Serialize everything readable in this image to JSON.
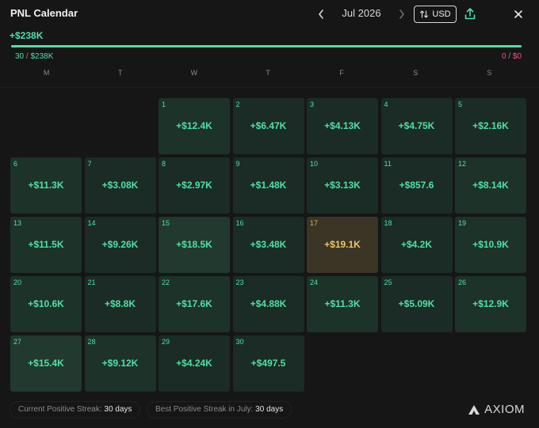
{
  "header": {
    "title": "PNL Calendar",
    "month_label": "Jul 2026",
    "prev_icon": "chevron-left-icon",
    "next_icon": "chevron-right-icon",
    "currency_label": "USD",
    "currency_icon": "swap-vertical-icon",
    "share_icon": "share-upload-icon",
    "close_icon": "close-icon"
  },
  "summary": {
    "total_pnl": "+$238K",
    "gain_progress_fraction": 1.0,
    "gain_count": "30",
    "gain_sep": "/",
    "gain_total": "$238K",
    "loss_count": "0",
    "loss_sep": "/",
    "loss_total": "$0"
  },
  "weekdays": [
    "M",
    "T",
    "W",
    "T",
    "F",
    "S",
    "S"
  ],
  "calendar": {
    "leading_empty_days": 2,
    "today_day": "17",
    "days": [
      {
        "day": "1",
        "value": "+$12.4K"
      },
      {
        "day": "2",
        "value": "+$6.47K"
      },
      {
        "day": "3",
        "value": "+$4.13K"
      },
      {
        "day": "4",
        "value": "+$4.75K"
      },
      {
        "day": "5",
        "value": "+$2.16K"
      },
      {
        "day": "6",
        "value": "+$11.3K"
      },
      {
        "day": "7",
        "value": "+$3.08K"
      },
      {
        "day": "8",
        "value": "+$2.97K"
      },
      {
        "day": "9",
        "value": "+$1.48K"
      },
      {
        "day": "10",
        "value": "+$3.13K"
      },
      {
        "day": "11",
        "value": "+$857.6"
      },
      {
        "day": "12",
        "value": "+$8.14K"
      },
      {
        "day": "13",
        "value": "+$11.5K"
      },
      {
        "day": "14",
        "value": "+$9.26K"
      },
      {
        "day": "15",
        "value": "+$18.5K"
      },
      {
        "day": "16",
        "value": "+$3.48K"
      },
      {
        "day": "17",
        "value": "+$19.1K"
      },
      {
        "day": "18",
        "value": "+$4.2K"
      },
      {
        "day": "19",
        "value": "+$10.9K"
      },
      {
        "day": "20",
        "value": "+$10.6K"
      },
      {
        "day": "21",
        "value": "+$8.8K"
      },
      {
        "day": "22",
        "value": "+$17.6K"
      },
      {
        "day": "23",
        "value": "+$4.88K"
      },
      {
        "day": "24",
        "value": "+$11.3K"
      },
      {
        "day": "25",
        "value": "+$5.09K"
      },
      {
        "day": "26",
        "value": "+$12.9K"
      },
      {
        "day": "27",
        "value": "+$15.4K"
      },
      {
        "day": "28",
        "value": "+$9.12K"
      },
      {
        "day": "29",
        "value": "+$4.24K"
      },
      {
        "day": "30",
        "value": "+$497.5"
      }
    ]
  },
  "footer": {
    "current_streak_label": "Current Positive Streak:",
    "current_streak_value": "30 days",
    "best_streak_label": "Best Positive Streak in July:",
    "best_streak_value": "30 days",
    "logo_text": "AXIOM",
    "logo_icon": "axiom-logo-icon"
  },
  "colors": {
    "gain": "#4fe0a6",
    "loss": "#ff4f7a",
    "today_accent": "#f2c46b",
    "background": "#161617"
  }
}
